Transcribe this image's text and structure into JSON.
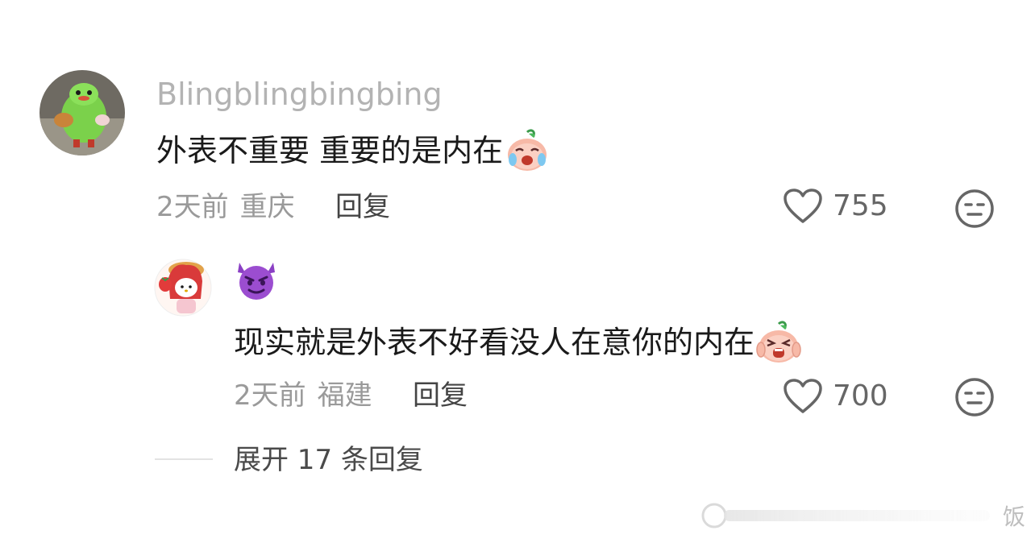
{
  "comments": [
    {
      "username": "Blingblingbingbing",
      "text": "外表不重要 重要的是内在",
      "emoji_icon": "crying-peach-emoji-icon",
      "time": "2天前",
      "location": "重庆",
      "reply_label": "回复",
      "likes": "755"
    }
  ],
  "reply": {
    "username_emoji": "😈",
    "text": "现实就是外表不好看没人在意你的内在",
    "emoji_icon": "screaming-peach-emoji-icon",
    "time": "2天前",
    "location": "福建",
    "reply_label": "回复",
    "likes": "700"
  },
  "expand_label": "展开 17 条回复",
  "watermark_text": "饭",
  "colors": {
    "username": "#b3b3b3",
    "text": "#1a1a1a",
    "meta": "#9a9a9a",
    "icon": "#666666"
  },
  "icons": {
    "like": "heart-outline-icon",
    "dislike": "neutral-face-icon"
  }
}
